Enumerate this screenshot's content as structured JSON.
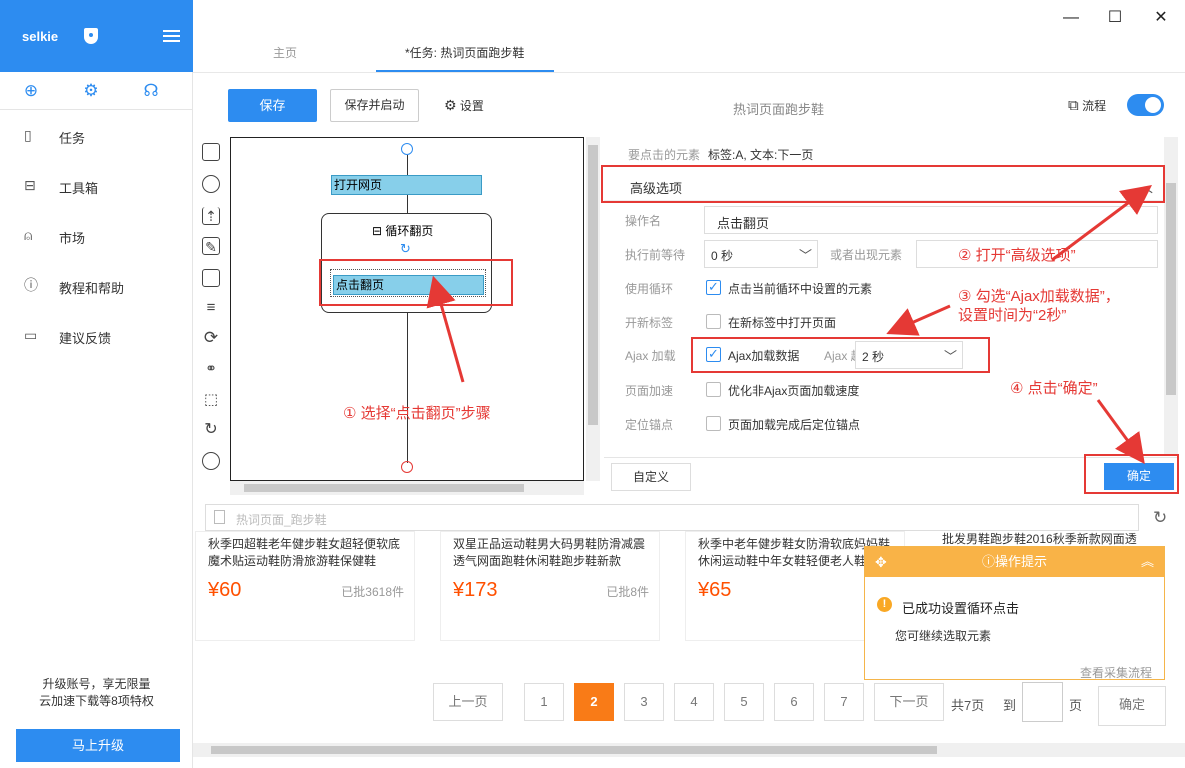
{
  "app": {
    "name": "selkie"
  },
  "tabs": [
    {
      "label": "主页"
    },
    {
      "label": "*任务: 热词页面跑步鞋"
    }
  ],
  "sidebar": {
    "items": [
      {
        "label": "任务",
        "icon": "file-icon"
      },
      {
        "label": "工具箱",
        "icon": "toolbox-icon"
      },
      {
        "label": "市场",
        "icon": "bag-icon"
      },
      {
        "label": "教程和帮助",
        "icon": "help-icon"
      },
      {
        "label": "建议反馈",
        "icon": "feedback-icon"
      }
    ],
    "upgrade_text_1": "升级账号，享无限量",
    "upgrade_text_2": "云加速下载等8项特权",
    "upgrade_button": "马上升级"
  },
  "toolbar": {
    "save": "保存",
    "save_run": "保存并启动",
    "settings": "设置",
    "task_title": "热词页面跑步鞋",
    "flow": "流程"
  },
  "flow": {
    "open_page": "打开网页",
    "loop": "循环翻页",
    "click_next": "点击翻页"
  },
  "panel": {
    "target_label": "要点击的元素",
    "target_value": "标签:A, 文本:下一页",
    "advanced": "高级选项",
    "op_name_label": "操作名",
    "op_name_value": "点击翻页",
    "wait_label": "执行前等待",
    "wait_value": "0 秒",
    "or_element": "或者出现元素",
    "use_loop_label": "使用循环",
    "use_loop_text": "点击当前循环中设置的元素",
    "new_tab_label": "开新标签",
    "new_tab_text": "在新标签中打开页面",
    "ajax_label": "Ajax 加载",
    "ajax_text": "Ajax加载数据",
    "ajax_timeout_label": "Ajax 超时",
    "ajax_timeout_value": "2 秒",
    "speedup_label": "页面加速",
    "speedup_text": "优化非Ajax页面加载速度",
    "anchor_label": "定位锚点",
    "anchor_text": "页面加载完成后定位锚点",
    "custom": "自定义",
    "ok": "确定"
  },
  "annotations": {
    "step1": "① 选择“点击翻页”步骤",
    "step2": "② 打开“高级选项”",
    "step3_line1": "③ 勾选“Ajax加载数据”，",
    "step3_line2": "设置时间为“2秒”",
    "step4": "④ 点击“确定”"
  },
  "urlbar": {
    "text": "热词页面_跑步鞋"
  },
  "products": [
    {
      "title": "秋季四超鞋老年健步鞋女超轻便软底魔术贴运动鞋防滑旅游鞋保健鞋",
      "price": "¥60",
      "sold": "已批3618件"
    },
    {
      "title": "双星正品运动鞋男大码男鞋防滑减震透气网面跑鞋休闲鞋跑步鞋新款",
      "price": "¥173",
      "sold": "已批8件"
    },
    {
      "title": "秋季中老年健步鞋女防滑软底妈妈鞋休闲运动鞋中年女鞋轻便老人鞋",
      "price": "¥65",
      "sold": "已批"
    },
    {
      "title": "批发男鞋跑步鞋2016秋季新款网面透",
      "price": "",
      "sold": ""
    }
  ],
  "notify": {
    "title": "操作提示",
    "message": "已成功设置循环点击",
    "sub": "您可继续选取元素",
    "link": "查看采集流程"
  },
  "pager": {
    "prev": "上一页",
    "pages": [
      "1",
      "2",
      "3",
      "4",
      "5",
      "6",
      "7"
    ],
    "current": "2",
    "next": "下一页",
    "total": "共7页",
    "goto": "到",
    "page_unit": "页",
    "confirm": "确定"
  }
}
